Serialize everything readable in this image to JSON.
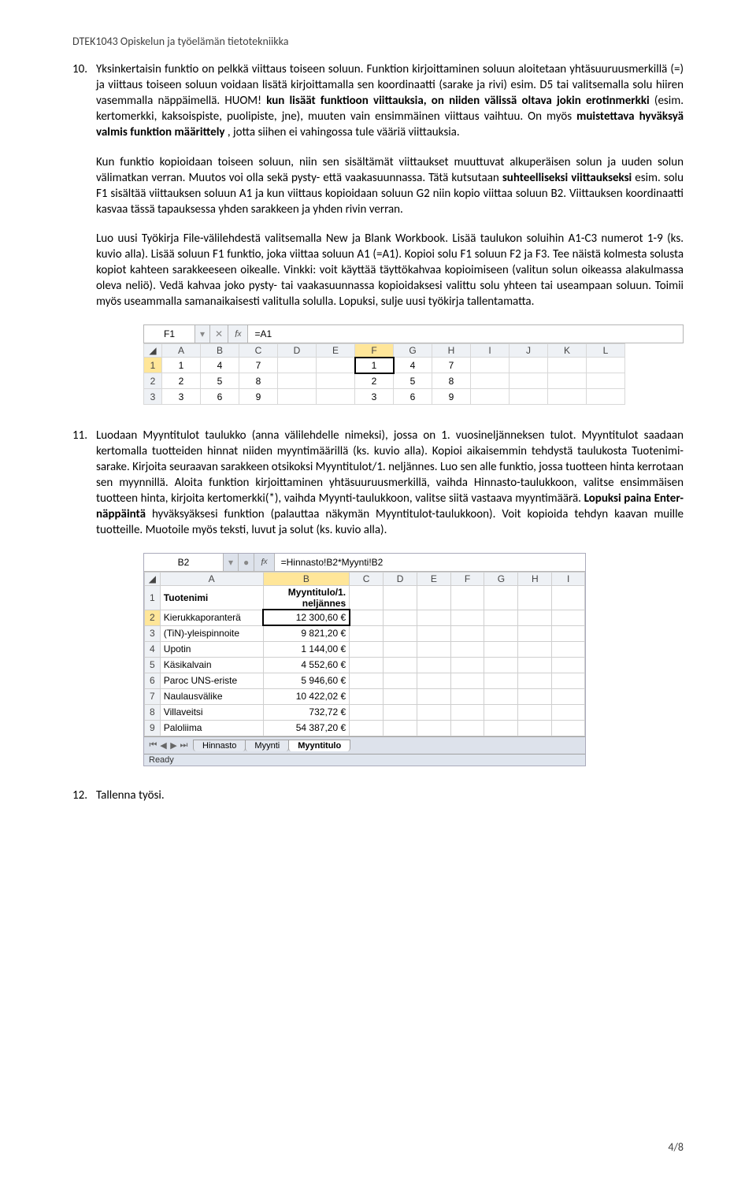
{
  "header": "DTEK1043 Opiskelun ja työelämän tietotekniikka",
  "item10": {
    "num": "10.",
    "body": "Yksinkertaisin funktio on pelkkä viittaus toiseen soluun. Funktion kirjoittaminen soluun aloitetaan yhtäsuuruusmerkillä (=) ja viittaus toiseen soluun voidaan lisätä kirjoittamalla sen koordinaatti (sarake ja rivi) esim. D5 tai valitsemalla solu hiiren vasemmalla näppäimellä. HUOM! ",
    "bold1": "kun lisäät funktioon viittauksia, on niiden välissä oltava jokin erotinmerkki",
    "body2": " (esim. kertomerkki, kaksoispiste, puolipiste, jne), muuten vain ensimmäinen viittaus vaihtuu. On myös ",
    "bold2": "muistettava hyväksyä valmis funktion määrittely",
    "body3": ", jotta siihen ei vahingossa tule vääriä viittauksia."
  },
  "para2": "Kun funktio kopioidaan toiseen soluun, niin sen sisältämät viittaukset muuttuvat alkuperäisen solun ja uuden solun välimatkan verran. Muutos voi olla sekä pysty- että vaakasuunnassa. Tätä kutsutaan ",
  "para2_bold": "suhteelliseksi viittaukseksi",
  "para2b": " esim. solu F1 sisältää viittauksen soluun A1 ja kun viittaus kopioidaan soluun G2 niin kopio viittaa soluun B2. Viittauksen koordinaatti kasvaa tässä tapauksessa yhden sarakkeen ja yhden rivin verran.",
  "para3": "Luo uusi Työkirja File-välilehdestä valitsemalla New ja Blank Workbook. Lisää taulukon soluihin A1-C3 numerot 1-9 (ks. kuvio alla). Lisää soluun F1 funktio, joka viittaa soluun A1 (=A1). Kopioi solu F1 soluun F2 ja F3. Tee näistä kolmesta solusta kopiot kahteen sarakkeeseen oikealle. Vinkki: voit käyttää täyttökahvaa kopioimiseen (valitun solun oikeassa alakulmassa oleva neliö). Vedä kahvaa joko pysty- tai vaakasuunnassa kopioidaksesi valittu solu yhteen tai useampaan soluun. Toimii myös useammalla samanaikaisesti valitulla solulla. Lopuksi, sulje uusi työkirja tallentamatta.",
  "sheet1": {
    "namebox": "F1",
    "formula": "=A1",
    "cols": [
      "A",
      "B",
      "C",
      "D",
      "E",
      "F",
      "G",
      "H",
      "I",
      "J",
      "K",
      "L"
    ],
    "rows": [
      {
        "n": "1",
        "cells": [
          "1",
          "4",
          "7",
          "",
          "",
          "1",
          "4",
          "7",
          "",
          "",
          "",
          ""
        ]
      },
      {
        "n": "2",
        "cells": [
          "2",
          "5",
          "8",
          "",
          "",
          "2",
          "5",
          "8",
          "",
          "",
          "",
          ""
        ]
      },
      {
        "n": "3",
        "cells": [
          "3",
          "6",
          "9",
          "",
          "",
          "3",
          "6",
          "9",
          "",
          "",
          "",
          ""
        ]
      }
    ],
    "active": {
      "row": 0,
      "col": 5
    }
  },
  "item11": {
    "num": "11.",
    "body": "Luodaan Myyntitulot taulukko (anna välilehdelle nimeksi), jossa on 1. vuosineljänneksen tulot. Myyntitulot saadaan kertomalla tuotteiden hinnat niiden myyntimäärillä (ks. kuvio alla). Kopioi aikaisemmin tehdystä taulukosta Tuotenimi-sarake. Kirjoita seuraavan sarakkeen otsikoksi Myyntitulot/1. neljännes. Luo sen alle funktio, jossa tuotteen hinta kerrotaan sen myynnillä. Aloita funktion kirjoittaminen yhtäsuuruusmerkillä, vaihda Hinnasto-taulukkoon, valitse ensimmäisen tuotteen hinta, kirjoita kertomerkki(*), vaihda Myynti-taulukkoon, valitse siitä vastaava myyntimäärä. ",
    "bold": "Lopuksi paina Enter-näppäintä",
    "body2": " hyväksyäksesi funktion (palauttaa näkymän Myyntitulot-taulukkoon). Voit kopioida tehdyn kaavan muille tuotteille. Muotoile myös teksti, luvut ja solut (ks. kuvio alla)."
  },
  "sheet2": {
    "namebox": "B2",
    "formula": "=Hinnasto!B2*Myynti!B2",
    "cols": [
      "A",
      "B",
      "C",
      "D",
      "E",
      "F",
      "G",
      "H",
      "I"
    ],
    "header_row": {
      "n": "1",
      "a": "Tuotenimi",
      "b": "Myyntitulo/1. neljännes"
    },
    "rows": [
      {
        "n": "2",
        "a": "Kierukkaporanterä",
        "b": "12 300,60 €",
        "active": true
      },
      {
        "n": "3",
        "a": "(TiN)-yleispinnoite",
        "b": "9 821,20 €"
      },
      {
        "n": "4",
        "a": "Upotin",
        "b": "1 144,00 €"
      },
      {
        "n": "5",
        "a": "Käsikalvain",
        "b": "4 552,60 €"
      },
      {
        "n": "6",
        "a": "Paroc UNS-eriste",
        "b": "5 946,60 €"
      },
      {
        "n": "7",
        "a": "Naulausvälike",
        "b": "10 422,02 €"
      },
      {
        "n": "8",
        "a": "Villaveitsi",
        "b": "732,72 €"
      },
      {
        "n": "9",
        "a": "Paloliima",
        "b": "54 387,20 €"
      }
    ],
    "tabs": [
      "Hinnasto",
      "Myynti",
      "Myyntitulo"
    ],
    "activeTab": 2,
    "status": "Ready"
  },
  "item12": {
    "num": "12.",
    "body": "Tallenna työsi."
  },
  "pagenum": "4/8"
}
